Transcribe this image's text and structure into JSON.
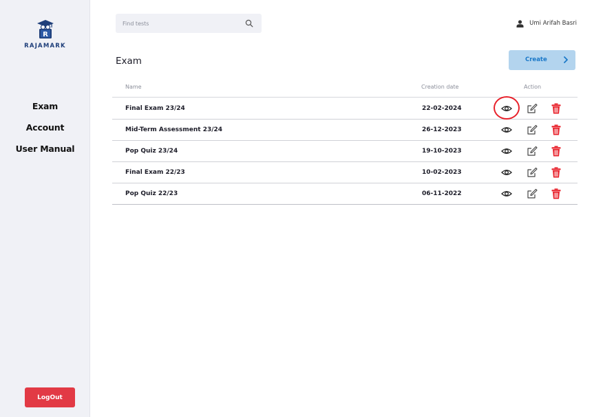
{
  "brand": {
    "name": "RAJAMARK",
    "logo_icon": "graduation-book-logo"
  },
  "sidebar": {
    "items": [
      {
        "label": "Exam"
      },
      {
        "label": "Account"
      },
      {
        "label": "User Manual"
      }
    ],
    "logout_label": "LogOut",
    "logout_color": "#e23a45"
  },
  "search": {
    "placeholder": "Find tests",
    "value": "",
    "icon": "search-icon"
  },
  "user": {
    "name": "Umi Arifah Basri",
    "icon": "user-icon"
  },
  "page": {
    "title": "Exam"
  },
  "create_button": {
    "label": "Create",
    "icon": "chevron-right-icon",
    "bg_color": "#b3d4ee",
    "text_color": "#1a78c8"
  },
  "table": {
    "columns": {
      "name": "Name",
      "date": "Creation date",
      "action": "Action"
    },
    "rows": [
      {
        "name": "Final Exam 23/24",
        "date": "22-02-2024"
      },
      {
        "name": "Mid-Term Assessment 23/24",
        "date": "26-12-2023"
      },
      {
        "name": "Pop Quiz 23/24",
        "date": "19-10-2023"
      },
      {
        "name": "Final Exam 22/23",
        "date": "10-02-2023"
      },
      {
        "name": "Pop Quiz 22/23",
        "date": "06-11-2022"
      }
    ],
    "action_icons": [
      "eye-icon",
      "edit-icon",
      "trash-icon"
    ],
    "highlighted": {
      "row": 0,
      "action": "eye-icon",
      "color": "#e8202a"
    }
  }
}
